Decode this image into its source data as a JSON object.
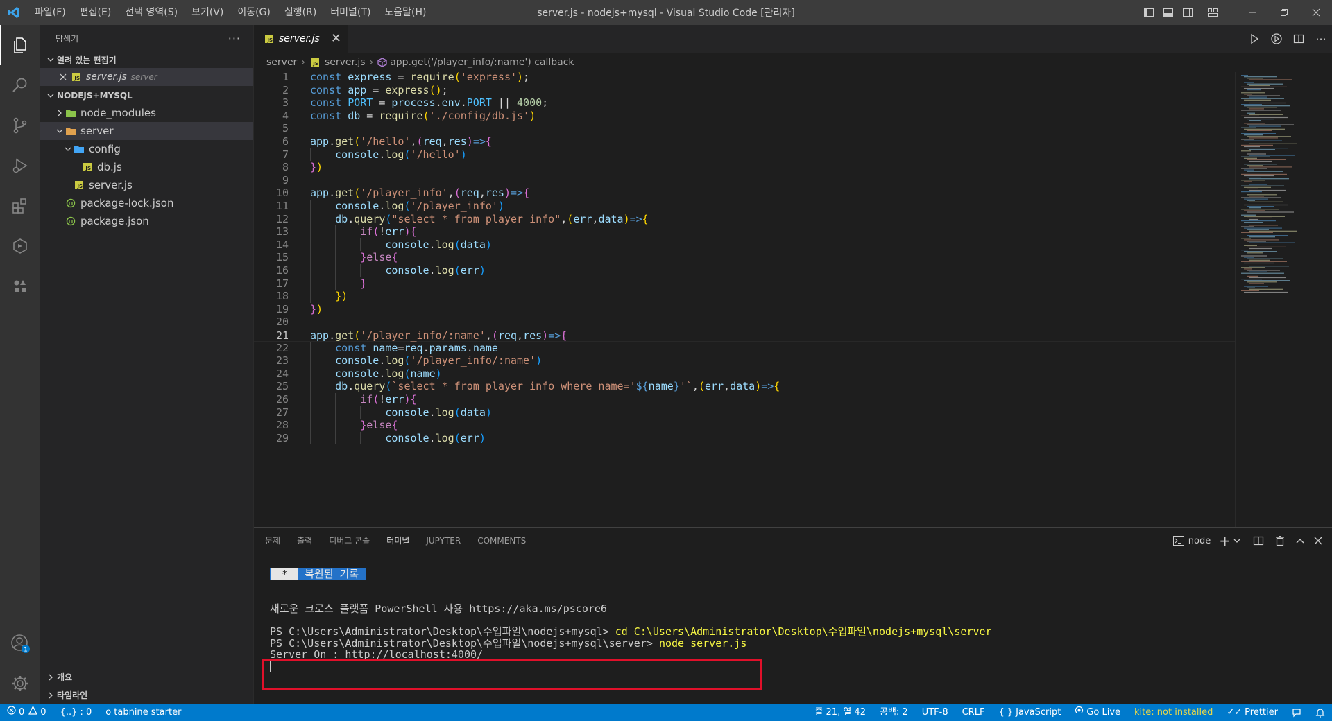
{
  "titlebar": {
    "menu": [
      "파일(F)",
      "편집(E)",
      "선택 영역(S)",
      "보기(V)",
      "이동(G)",
      "실행(R)",
      "터미널(T)",
      "도움말(H)"
    ],
    "title": "server.js - nodejs+mysql - Visual Studio Code [관리자]"
  },
  "sidebar": {
    "header": "탐색기",
    "open_editors_label": "열려 있는 편집기",
    "open_editor": {
      "name": "server.js",
      "folder": "server"
    },
    "workspace_label": "NODEJS+MYSQL",
    "tree": [
      {
        "name": "node_modules",
        "level": 1,
        "kind": "folder-collapsed"
      },
      {
        "name": "server",
        "level": 1,
        "kind": "folder-open"
      },
      {
        "name": "config",
        "level": 2,
        "kind": "folder-open"
      },
      {
        "name": "db.js",
        "level": 3,
        "kind": "js"
      },
      {
        "name": "server.js",
        "level": 2,
        "kind": "js"
      },
      {
        "name": "package-lock.json",
        "level": 1,
        "kind": "json"
      },
      {
        "name": "package.json",
        "level": 1,
        "kind": "json"
      }
    ],
    "outline_label": "개요",
    "timeline_label": "타임라인"
  },
  "editor": {
    "tab_label": "server.js",
    "breadcrumb": [
      "server",
      "server.js",
      "app.get('/player_info/:name') callback"
    ],
    "current_line": 21,
    "lines": [
      [
        [
          "k",
          "const "
        ],
        [
          "v",
          "express"
        ],
        [
          "p",
          " = "
        ],
        [
          "f",
          "require"
        ],
        [
          "b1",
          "("
        ],
        [
          "s",
          "'express'"
        ],
        [
          "b1",
          ")"
        ],
        [
          "p",
          ";"
        ]
      ],
      [
        [
          "k",
          "const "
        ],
        [
          "v",
          "app"
        ],
        [
          "p",
          " = "
        ],
        [
          "f",
          "express"
        ],
        [
          "b1",
          "()"
        ],
        [
          "p",
          ";"
        ]
      ],
      [
        [
          "k",
          "const "
        ],
        [
          "c",
          "PORT"
        ],
        [
          "p",
          " = "
        ],
        [
          "v",
          "process"
        ],
        [
          "p",
          "."
        ],
        [
          "v",
          "env"
        ],
        [
          "p",
          "."
        ],
        [
          "c",
          "PORT"
        ],
        [
          "p",
          " || "
        ],
        [
          "n",
          "4000"
        ],
        [
          "p",
          ";"
        ]
      ],
      [
        [
          "k",
          "const "
        ],
        [
          "v",
          "db"
        ],
        [
          "p",
          " = "
        ],
        [
          "f",
          "require"
        ],
        [
          "b1",
          "("
        ],
        [
          "s",
          "'./config/db.js'"
        ],
        [
          "b1",
          ")"
        ]
      ],
      [],
      [
        [
          "v",
          "app"
        ],
        [
          "p",
          "."
        ],
        [
          "f",
          "get"
        ],
        [
          "b1",
          "("
        ],
        [
          "s",
          "'/hello'"
        ],
        [
          "p",
          ","
        ],
        [
          "b2",
          "("
        ],
        [
          "v",
          "req"
        ],
        [
          "p",
          ","
        ],
        [
          "v",
          "res"
        ],
        [
          "b2",
          ")"
        ],
        [
          "k",
          "=>"
        ],
        [
          "b2",
          "{"
        ]
      ],
      [
        [
          "p",
          "    "
        ],
        [
          "v",
          "console"
        ],
        [
          "p",
          "."
        ],
        [
          "f",
          "log"
        ],
        [
          "b3",
          "("
        ],
        [
          "s",
          "'/hello'"
        ],
        [
          "b3",
          ")"
        ]
      ],
      [
        [
          "b2",
          "}"
        ],
        [
          "b1",
          ")"
        ]
      ],
      [],
      [
        [
          "v",
          "app"
        ],
        [
          "p",
          "."
        ],
        [
          "f",
          "get"
        ],
        [
          "b1",
          "("
        ],
        [
          "s",
          "'/player_info'"
        ],
        [
          "p",
          ","
        ],
        [
          "b2",
          "("
        ],
        [
          "v",
          "req"
        ],
        [
          "p",
          ","
        ],
        [
          "v",
          "res"
        ],
        [
          "b2",
          ")"
        ],
        [
          "k",
          "=>"
        ],
        [
          "b2",
          "{"
        ]
      ],
      [
        [
          "p",
          "    "
        ],
        [
          "v",
          "console"
        ],
        [
          "p",
          "."
        ],
        [
          "f",
          "log"
        ],
        [
          "b3",
          "("
        ],
        [
          "s",
          "'/player_info'"
        ],
        [
          "b3",
          ")"
        ]
      ],
      [
        [
          "p",
          "    "
        ],
        [
          "v",
          "db"
        ],
        [
          "p",
          "."
        ],
        [
          "f",
          "query"
        ],
        [
          "b3",
          "("
        ],
        [
          "s",
          "\"select * from player_info\""
        ],
        [
          "p",
          ","
        ],
        [
          "b1",
          "("
        ],
        [
          "v",
          "err"
        ],
        [
          "p",
          ","
        ],
        [
          "v",
          "data"
        ],
        [
          "b1",
          ")"
        ],
        [
          "k",
          "=>"
        ],
        [
          "b1",
          "{"
        ]
      ],
      [
        [
          "p",
          "        "
        ],
        [
          "pk",
          "if"
        ],
        [
          "b2",
          "("
        ],
        [
          "p",
          "!"
        ],
        [
          "v",
          "err"
        ],
        [
          "b2",
          ")"
        ],
        [
          "b2",
          "{"
        ]
      ],
      [
        [
          "p",
          "            "
        ],
        [
          "v",
          "console"
        ],
        [
          "p",
          "."
        ],
        [
          "f",
          "log"
        ],
        [
          "b3",
          "("
        ],
        [
          "v",
          "data"
        ],
        [
          "b3",
          ")"
        ]
      ],
      [
        [
          "p",
          "        "
        ],
        [
          "b2",
          "}"
        ],
        [
          "pk",
          "else"
        ],
        [
          "b2",
          "{"
        ]
      ],
      [
        [
          "p",
          "            "
        ],
        [
          "v",
          "console"
        ],
        [
          "p",
          "."
        ],
        [
          "f",
          "log"
        ],
        [
          "b3",
          "("
        ],
        [
          "v",
          "err"
        ],
        [
          "b3",
          ")"
        ]
      ],
      [
        [
          "p",
          "        "
        ],
        [
          "b2",
          "}"
        ]
      ],
      [
        [
          "p",
          "    "
        ],
        [
          "b1",
          "})"
        ]
      ],
      [
        [
          "b2",
          "}"
        ],
        [
          "b1",
          ")"
        ]
      ],
      [],
      [
        [
          "v",
          "app"
        ],
        [
          "p",
          "."
        ],
        [
          "f",
          "get"
        ],
        [
          "b1",
          "("
        ],
        [
          "s",
          "'/player_info/:name'"
        ],
        [
          "p",
          ","
        ],
        [
          "b2",
          "("
        ],
        [
          "v",
          "req"
        ],
        [
          "p",
          ","
        ],
        [
          "v",
          "res"
        ],
        [
          "b2",
          ")"
        ],
        [
          "k",
          "=>"
        ],
        [
          "b2",
          "{"
        ]
      ],
      [
        [
          "p",
          "    "
        ],
        [
          "k",
          "const "
        ],
        [
          "v",
          "name"
        ],
        [
          "p",
          "="
        ],
        [
          "v",
          "req"
        ],
        [
          "p",
          "."
        ],
        [
          "v",
          "params"
        ],
        [
          "p",
          "."
        ],
        [
          "v",
          "name"
        ]
      ],
      [
        [
          "p",
          "    "
        ],
        [
          "v",
          "console"
        ],
        [
          "p",
          "."
        ],
        [
          "f",
          "log"
        ],
        [
          "b3",
          "("
        ],
        [
          "s",
          "'/player_info/:name'"
        ],
        [
          "b3",
          ")"
        ]
      ],
      [
        [
          "p",
          "    "
        ],
        [
          "v",
          "console"
        ],
        [
          "p",
          "."
        ],
        [
          "f",
          "log"
        ],
        [
          "b3",
          "("
        ],
        [
          "v",
          "name"
        ],
        [
          "b3",
          ")"
        ]
      ],
      [
        [
          "p",
          "    "
        ],
        [
          "v",
          "db"
        ],
        [
          "p",
          "."
        ],
        [
          "f",
          "query"
        ],
        [
          "b3",
          "("
        ],
        [
          "s",
          "`select * from player_info where name='"
        ],
        [
          "k",
          "${"
        ],
        [
          "v",
          "name"
        ],
        [
          "k",
          "}"
        ],
        [
          "s",
          "'`"
        ],
        [
          "p",
          ","
        ],
        [
          "b1",
          "("
        ],
        [
          "v",
          "err"
        ],
        [
          "p",
          ","
        ],
        [
          "v",
          "data"
        ],
        [
          "b1",
          ")"
        ],
        [
          "k",
          "=>"
        ],
        [
          "b1",
          "{"
        ]
      ],
      [
        [
          "p",
          "        "
        ],
        [
          "pk",
          "if"
        ],
        [
          "b2",
          "("
        ],
        [
          "p",
          "!"
        ],
        [
          "v",
          "err"
        ],
        [
          "b2",
          ")"
        ],
        [
          "b2",
          "{"
        ]
      ],
      [
        [
          "p",
          "            "
        ],
        [
          "v",
          "console"
        ],
        [
          "p",
          "."
        ],
        [
          "f",
          "log"
        ],
        [
          "b3",
          "("
        ],
        [
          "v",
          "data"
        ],
        [
          "b3",
          ")"
        ]
      ],
      [
        [
          "p",
          "        "
        ],
        [
          "b2",
          "}"
        ],
        [
          "pk",
          "else"
        ],
        [
          "b2",
          "{"
        ]
      ],
      [
        [
          "p",
          "            "
        ],
        [
          "v",
          "console"
        ],
        [
          "p",
          "."
        ],
        [
          "f",
          "log"
        ],
        [
          "b3",
          "("
        ],
        [
          "v",
          "err"
        ],
        [
          "b3",
          ")"
        ]
      ]
    ]
  },
  "panel": {
    "tabs": [
      "문제",
      "출력",
      "디버그 콘솔",
      "터미널",
      "JUPYTER",
      "COMMENTS"
    ],
    "active_tab": "터미널",
    "terminal_name": "node",
    "terminal": {
      "restore_star": " * ",
      "restore_text": " 복원된 기록 ",
      "powershell_line": "새로운 크로스 플랫폼 PowerShell 사용 https://aka.ms/pscore6",
      "prompt1": "PS C:\\Users\\Administrator\\Desktop\\수업파일\\nodejs+mysql> ",
      "cmd1": "cd C:\\Users\\Administrator\\Desktop\\수업파일\\nodejs+mysql\\server",
      "prompt2": "PS C:\\Users\\Administrator\\Desktop\\수업파일\\nodejs+mysql\\server> ",
      "cmd2": "node server.js",
      "output": "Server On : http://localhost:4000/"
    }
  },
  "statusbar": {
    "errors": "0",
    "warnings": "0",
    "braces": "{..} : 0",
    "tabnine": "tabnine starter",
    "position": "줄 21, 열 42",
    "spaces": "공백: 2",
    "encoding": "UTF-8",
    "eol": "CRLF",
    "language": "JavaScript",
    "golive": "Go Live",
    "kite": "kite: not installed",
    "prettier": "Prettier"
  },
  "colors": {
    "accent": "#007acc",
    "highlight_box": "#e0102a"
  }
}
